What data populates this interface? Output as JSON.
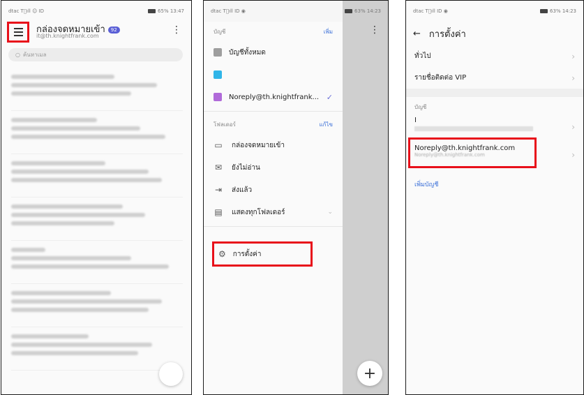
{
  "panel1": {
    "status_left": "dtac T᪴ıll ☺ ID",
    "status_right": "65% 13:47",
    "title": "กล่องจดหมายเข้า",
    "unread_count": "92",
    "account": "it@th.knightfrank.com",
    "search_placeholder": "ค้นหาเมล"
  },
  "panel2": {
    "status_left": "dtac T᪴ıll ID ◉",
    "status_right": "63% 14:23",
    "accounts_header": "บัญชี",
    "add_label": "เพิ่ม",
    "accounts": [
      {
        "label": "บัญชีทั้งหมด",
        "color": "#9e9e9e"
      },
      {
        "label": "",
        "color": "#30b5e8"
      },
      {
        "label": "Noreply@th.knightfrank...",
        "color": "#b06ad9",
        "active": true
      }
    ],
    "folders_header": "โฟลเดอร์",
    "edit_label": "แก้ไข",
    "folders": [
      {
        "label": "กล่องจดหมายเข้า",
        "icon": "inbox-icon"
      },
      {
        "label": "ยังไม่อ่าน",
        "icon": "unread-mail-icon"
      },
      {
        "label": "ส่งแล้ว",
        "icon": "sent-icon"
      },
      {
        "label": "แสดงทุกโฟลเดอร์",
        "icon": "folder-icon"
      }
    ],
    "settings_label": "การตั้งค่า"
  },
  "panel3": {
    "status_left": "dtac T᪴ıll ID ◉",
    "status_right": "63% 14:23",
    "title": "การตั้งค่า",
    "general": "ทั่วไป",
    "vip": "รายชื่อติดต่อ VIP",
    "accounts_label": "บัญชี",
    "account1_name": "I",
    "account2_name": "Noreply@th.knightfrank.com",
    "account2_email": "Noreply@th.knightfrank.com",
    "add_account": "เพิ่มบัญชี"
  },
  "colors": {
    "highlight": "#e8101a",
    "accent": "#3a6fd8",
    "badge": "#5a5fd6"
  }
}
